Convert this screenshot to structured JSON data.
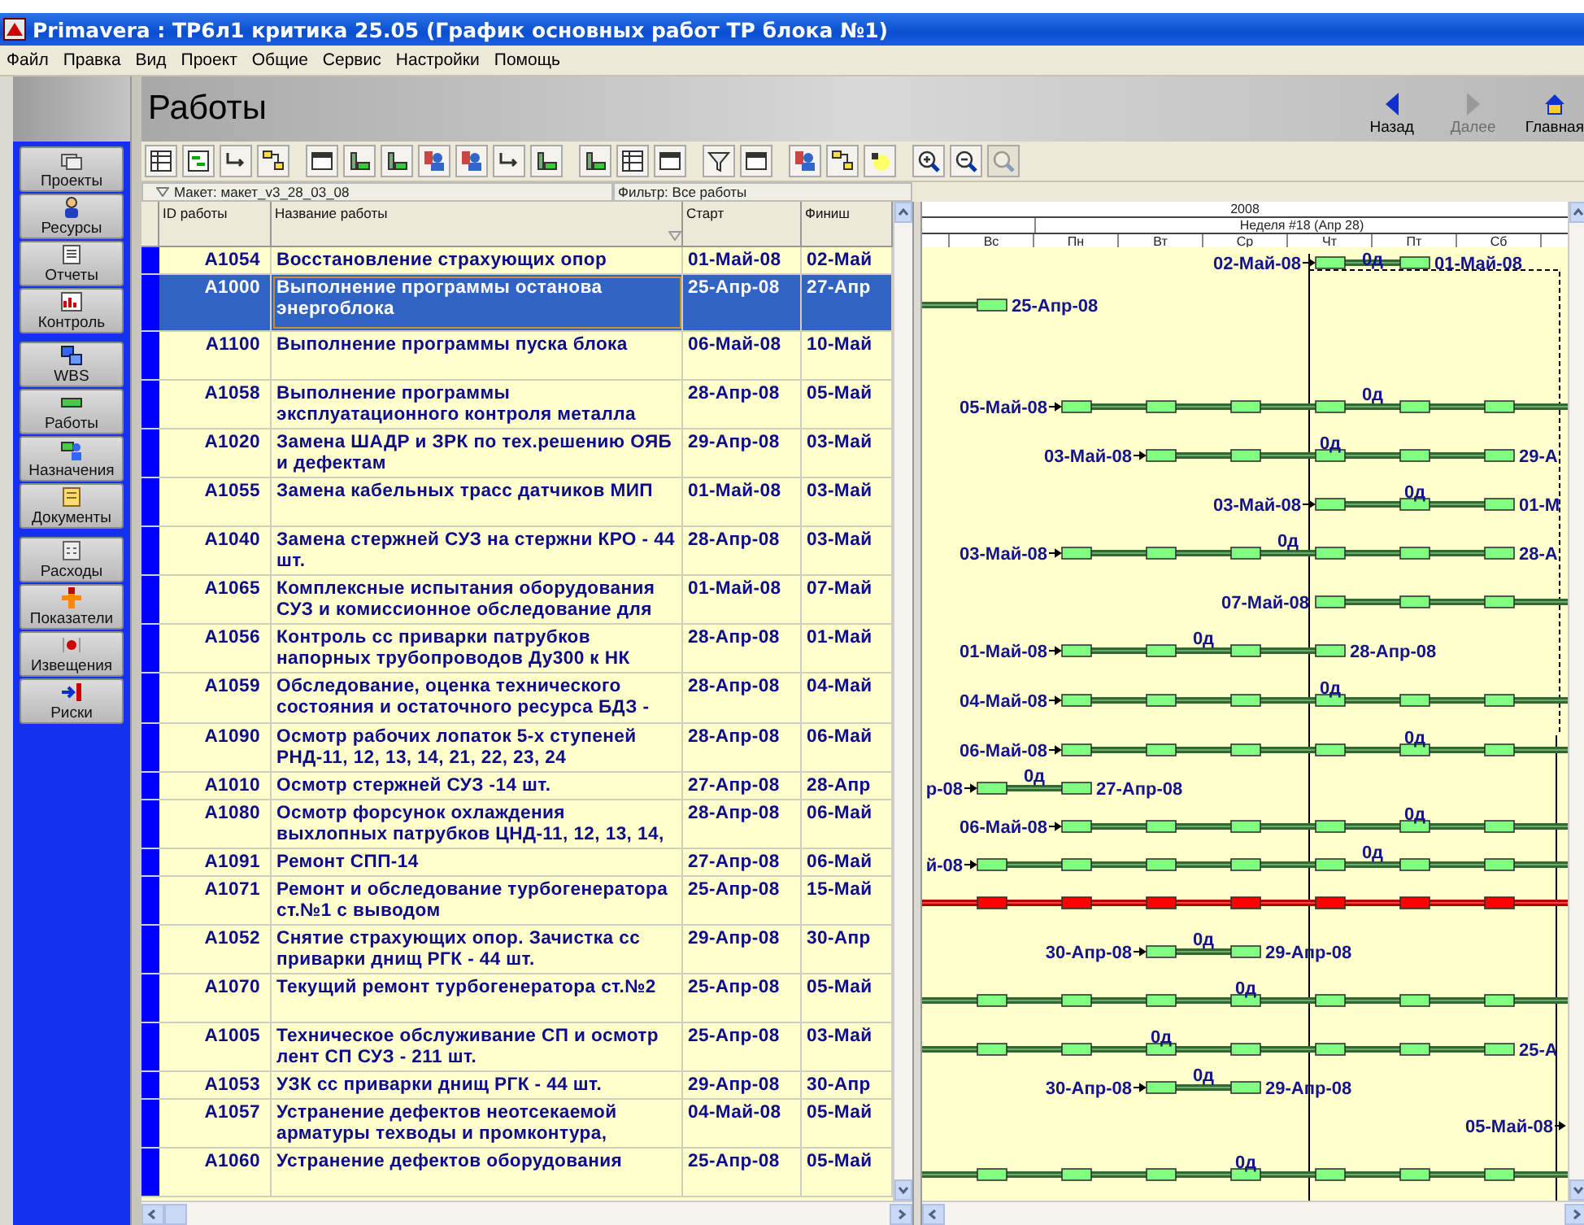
{
  "window": {
    "title": "Primavera : ТР6л1 критика 25.05 (График основных работ ТР блока №1)"
  },
  "menu": [
    "Файл",
    "Правка",
    "Вид",
    "Проект",
    "Общие",
    "Сервис",
    "Настройки",
    "Помощь"
  ],
  "sidebar": {
    "groups": [
      {
        "items": [
          {
            "label": "Проекты",
            "kind": "folders"
          },
          {
            "label": "Ресурсы",
            "kind": "person"
          },
          {
            "label": "Отчеты",
            "kind": "report"
          },
          {
            "label": "Контроль",
            "kind": "chart"
          }
        ]
      },
      {
        "items": [
          {
            "label": "WBS",
            "kind": "blocks"
          },
          {
            "label": "Работы",
            "kind": "bar"
          },
          {
            "label": "Назначения",
            "kind": "assign"
          },
          {
            "label": "Документы",
            "kind": "document"
          }
        ]
      },
      {
        "items": [
          {
            "label": "Расходы",
            "kind": "calculator"
          },
          {
            "label": "Показатели",
            "kind": "indicator"
          },
          {
            "label": "Извещения",
            "kind": "notice"
          },
          {
            "label": "Риски",
            "kind": "exit"
          }
        ]
      }
    ]
  },
  "header": {
    "title": "Работы",
    "nav": [
      {
        "label": "Назад",
        "kind": "back",
        "disabled": false
      },
      {
        "label": "Далее",
        "kind": "forward",
        "disabled": true
      },
      {
        "label": "Главная",
        "kind": "home",
        "disabled": false
      }
    ]
  },
  "toolbar": {
    "groups": [
      {
        "buttons": [
          {
            "kind": "table",
            "disabled": false
          },
          {
            "kind": "gantt",
            "disabled": false
          },
          {
            "kind": "link",
            "disabled": false
          },
          {
            "kind": "network",
            "disabled": false
          }
        ]
      },
      {
        "buttons": [
          {
            "kind": "window",
            "disabled": false
          },
          {
            "kind": "bars",
            "disabled": false
          },
          {
            "kind": "bars",
            "disabled": false
          },
          {
            "kind": "people",
            "disabled": false
          },
          {
            "kind": "people",
            "disabled": false
          },
          {
            "kind": "link",
            "disabled": false
          },
          {
            "kind": "bars",
            "disabled": false
          }
        ]
      },
      {
        "buttons": [
          {
            "kind": "bars",
            "disabled": false
          },
          {
            "kind": "table",
            "disabled": false
          },
          {
            "kind": "window",
            "disabled": false
          }
        ]
      },
      {
        "buttons": [
          {
            "kind": "filter",
            "disabled": false
          },
          {
            "kind": "window",
            "disabled": false
          }
        ]
      },
      {
        "buttons": [
          {
            "kind": "people",
            "disabled": false
          },
          {
            "kind": "network",
            "disabled": false
          },
          {
            "kind": "bulb",
            "disabled": false
          }
        ]
      },
      {
        "buttons": [
          {
            "kind": "zoom-in",
            "disabled": false
          },
          {
            "kind": "zoom-out",
            "disabled": false
          },
          {
            "kind": "zoom-fit",
            "disabled": true
          }
        ]
      }
    ]
  },
  "layout_bar": {
    "layout": "Макет: макет_v3_28_03_08",
    "filter": "Фильтр: Все работы"
  },
  "table": {
    "columns": [
      "ID работы",
      "Название работы",
      "Старт",
      "Финиш"
    ],
    "rows": [
      {
        "id": "A1054",
        "name": "Восстановление страхующих опор",
        "start": "01-Май-08",
        "finish": "02-Май",
        "selected": false,
        "bar": {
          "left_label": "02-Май-08",
          "float_label": "0д",
          "right_label": "01-Май-08",
          "critical": false
        }
      },
      {
        "id": "A1000",
        "name": "Выполнение программы останова энергоблока",
        "start": "25-Апр-08",
        "finish": "27-Апр",
        "selected": true,
        "bar": {
          "right_label": "25-Апр-08",
          "critical": false
        }
      },
      {
        "id": "A1100",
        "name": "Выполнение программы пуска блока",
        "start": "06-Май-08",
        "finish": "10-Май",
        "selected": false
      },
      {
        "id": "A1058",
        "name": "Выполнение программы эксплуатационного контроля металла",
        "start": "28-Апр-08",
        "finish": "05-Май",
        "selected": false,
        "bar": {
          "left_label": "05-Май-08",
          "float_label": "0д",
          "critical": false
        }
      },
      {
        "id": "A1020",
        "name": "Замена ШАДР и ЗРК по тех.решению ОЯБ и дефектам",
        "start": "29-Апр-08",
        "finish": "03-Май",
        "selected": false,
        "bar": {
          "left_label": "03-Май-08",
          "float_label": "0д",
          "right_label": "29-А",
          "critical": false
        }
      },
      {
        "id": "A1055",
        "name": "Замена кабельных трасс датчиков МИП",
        "start": "01-Май-08",
        "finish": "03-Май",
        "selected": false,
        "bar": {
          "left_label": "03-Май-08",
          "float_label": "0д",
          "right_label": "01-М",
          "critical": false
        }
      },
      {
        "id": "A1040",
        "name": "Замена стержней СУЗ на стержни КРО - 44 шт.",
        "start": "28-Апр-08",
        "finish": "03-Май",
        "selected": false,
        "bar": {
          "left_label": "03-Май-08",
          "float_label": "0д",
          "right_label": "28-А",
          "critical": false
        }
      },
      {
        "id": "A1065",
        "name": "Комплексные испытания оборудования СУЗ и комиссионное обследование для",
        "start": "01-Май-08",
        "finish": "07-Май",
        "selected": false,
        "bar": {
          "left_label": "07-Май-08",
          "critical": false
        }
      },
      {
        "id": "A1056",
        "name": "Контроль сс приварки патрубков напорных трубопроводов Ду300 к НК",
        "start": "28-Апр-08",
        "finish": "01-Май",
        "selected": false,
        "bar": {
          "left_label": "01-Май-08",
          "float_label": "0д",
          "right_label": "28-Апр-08",
          "critical": false
        }
      },
      {
        "id": "A1059",
        "name": "Обследование, оценка технического состояния и остаточного ресурса БДЗ -",
        "start": "28-Апр-08",
        "finish": "04-Май",
        "selected": false,
        "bar": {
          "left_label": "04-Май-08",
          "float_label": "0д",
          "critical": false
        }
      },
      {
        "id": "A1090",
        "name": "Осмотр рабочих лопаток 5-х ступеней РНД-11, 12, 13, 14, 21, 22, 23, 24",
        "start": "28-Апр-08",
        "finish": "06-Май",
        "selected": false,
        "bar": {
          "left_label": "06-Май-08",
          "float_label": "0д",
          "critical": false
        }
      },
      {
        "id": "A1010",
        "name": "Осмотр стержней СУЗ -14 шт.",
        "start": "27-Апр-08",
        "finish": "28-Апр",
        "selected": false,
        "bar": {
          "left_label": "р-08",
          "float_label": "0д",
          "right_label": "27-Апр-08",
          "critical": false
        }
      },
      {
        "id": "A1080",
        "name": "Осмотр форсунок охлаждения выхлопных патрубков ЦНД-11, 12, 13, 14,",
        "start": "28-Апр-08",
        "finish": "06-Май",
        "selected": false,
        "bar": {
          "left_label": "06-Май-08",
          "float_label": "0д",
          "critical": false
        }
      },
      {
        "id": "A1091",
        "name": "Ремонт СПП-14",
        "start": "27-Апр-08",
        "finish": "06-Май",
        "selected": false,
        "bar": {
          "left_label": "й-08",
          "float_label": "0д",
          "critical": false
        }
      },
      {
        "id": "A1071",
        "name": "Ремонт и обследование турбогенератора ст.№1 с выводом",
        "start": "25-Апр-08",
        "finish": "15-Май",
        "selected": false,
        "bar": {
          "critical": true
        }
      },
      {
        "id": "A1052",
        "name": "Снятие страхующих опор. Зачистка сс приварки днищ РГК - 44 шт.",
        "start": "29-Апр-08",
        "finish": "30-Апр",
        "selected": false,
        "bar": {
          "left_label": "30-Апр-08",
          "float_label": "0д",
          "right_label": "29-Апр-08",
          "critical": false
        }
      },
      {
        "id": "A1070",
        "name": "Текущий ремонт турбогенератора ст.№2",
        "start": "25-Апр-08",
        "finish": "05-Май",
        "selected": false,
        "bar": {
          "float_label": "0д",
          "critical": false
        }
      },
      {
        "id": "A1005",
        "name": "Техническое обслуживание СП и осмотр лент СП СУЗ - 211 шт.",
        "start": "25-Апр-08",
        "finish": "03-Май",
        "selected": false,
        "bar": {
          "float_label": "0д",
          "right_label": "25-А",
          "critical": false
        }
      },
      {
        "id": "A1053",
        "name": "УЗК сс приварки днищ РГК - 44 шт.",
        "start": "29-Апр-08",
        "finish": "30-Апр",
        "selected": false,
        "bar": {
          "left_label": "30-Апр-08",
          "float_label": "0д",
          "right_label": "29-Апр-08",
          "critical": false
        }
      },
      {
        "id": "A1057",
        "name": "Устранение дефектов неотсекаемой арматуры техводы и промконтура,",
        "start": "04-Май-08",
        "finish": "05-Май",
        "selected": false,
        "bar": {
          "left_label": "05-Май-08"
        }
      },
      {
        "id": "A1060",
        "name": "Устранение дефектов оборудования",
        "start": "25-Апр-08",
        "finish": "05-Май",
        "selected": false,
        "bar": {
          "float_label": "0д",
          "critical": false
        }
      }
    ]
  },
  "gantt": {
    "year": "2008",
    "week": "Неделя #18 (Апр 28)",
    "days": [
      "Вс",
      "Пн",
      "Вт",
      "Ср",
      "Чт",
      "Пт",
      "Сб"
    ]
  }
}
